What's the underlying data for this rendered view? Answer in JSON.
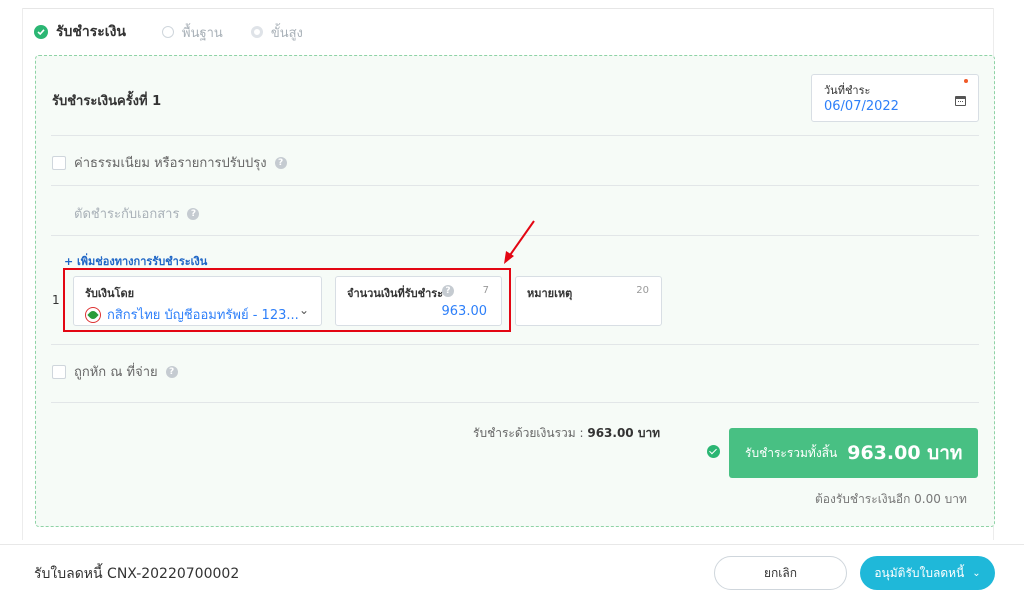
{
  "mode": {
    "label": "รับชำระเงิน",
    "options": [
      "พื้นฐาน",
      "ขั้นสูง"
    ]
  },
  "panel": {
    "title": "รับชำระเงินครั้งที่ 1",
    "date": {
      "label": "วันที่ชำระ",
      "value": "06/07/2022"
    },
    "fee_option": "ค่าธรรมเนียม หรือรายการปรับปรุง",
    "offset_option": "ตัดชำระกับเอกสาร",
    "add_channel": "+ เพิ่มช่องทางการรับชำระเงิน",
    "row_number": "1",
    "receive_by": {
      "label": "รับเงินโดย",
      "value": "กสิกรไทย บัญชีออมทรัพย์ - 123..."
    },
    "amount": {
      "label": "จำนวนเงินที่รับชำระ",
      "count": "7",
      "value": "963.00"
    },
    "note": {
      "label": "หมายเหตุ",
      "count": "20"
    },
    "withholding_option": "ถูกหัก ณ ที่จ่าย",
    "sum_label": "รับชำระด้วยเงินรวม :",
    "sum_value": "963.00 บาท",
    "total_label": "รับชำระรวมทั้งสิ้น",
    "total_value": "963.00 บาท",
    "remaining": "ต้องรับชำระเงินอีก 0.00 บาท"
  },
  "footer": {
    "title": "รับใบลดหนี้ CNX-20220700002",
    "cancel": "ยกเลิก",
    "approve": "อนุมัติรับใบลดหนี้"
  },
  "colors": {
    "accent_green": "#48c083",
    "link_blue": "#2d7ff9",
    "annotation_red": "#e30613",
    "approve_cyan": "#1fb8d9"
  }
}
